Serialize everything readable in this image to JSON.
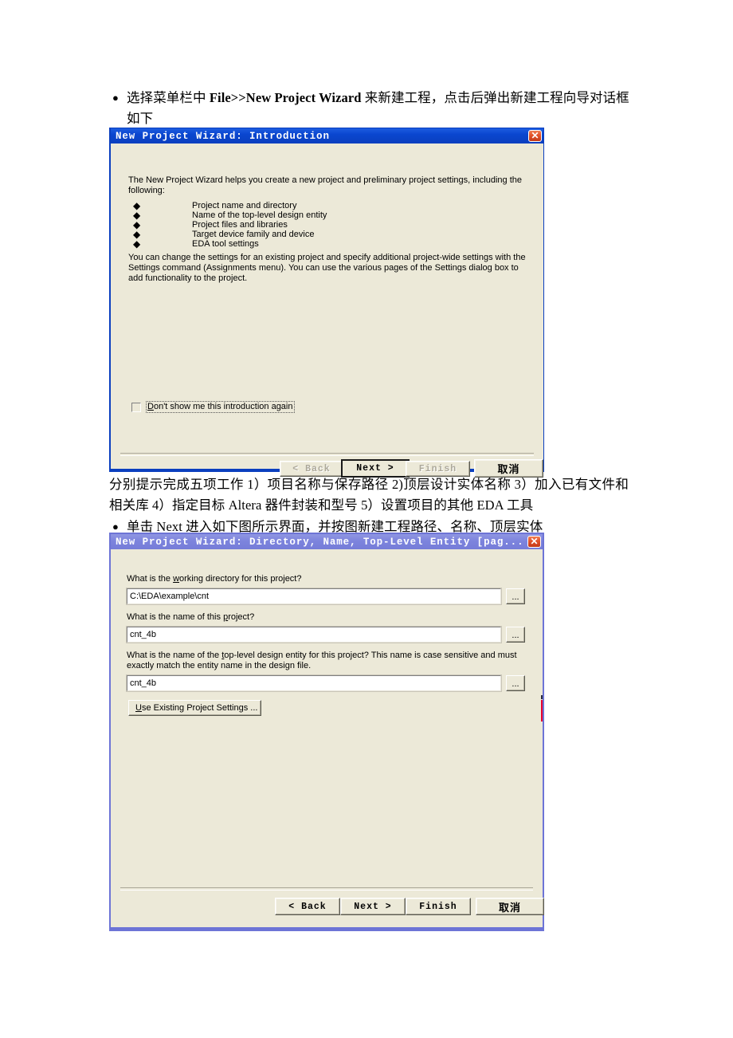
{
  "document": {
    "bullet_1": {
      "marker": "●",
      "line1_pre": "选择菜单栏中 ",
      "line1_bold": "File>>New Project Wizard",
      "line1_post": " 来新建工程，点击后弹出新建工程向导对话框",
      "line2": "如下"
    },
    "paragraph_2": "分别提示完成五项工作 1）项目名称与保存路径 2)顶层设计实体名称 3）加入已有文件和相关库 4）指定目标 Altera 器件封装和型号 5）设置项目的其他 EDA 工具",
    "bullet_2": {
      "marker": "●",
      "text": "单击 Next 进入如下图所示界面，并按图新建工程路径、名称、顶层实体"
    }
  },
  "dialog_intro": {
    "title": "New Project Wizard: Introduction",
    "close_label": "✕",
    "intro_paragraph": "The New Project Wizard helps you create a new project and preliminary project settings, including the following:",
    "bullet_marker": "◆",
    "items": [
      "Project name and directory",
      "Name of the top-level design entity",
      "Project files and libraries",
      "Target device family and device",
      "EDA tool settings"
    ],
    "body_paragraph": "You can change the settings for an existing project and specify additional project-wide settings with the Settings command (Assignments menu). You can use the various pages of the Settings dialog box to add functionality to the project.",
    "checkbox": {
      "label_accel": "D",
      "label_rest": "on't show me this introduction again",
      "checked": false
    },
    "buttons": {
      "back": "< Back",
      "next": "Next >",
      "finish": "Finish",
      "cancel": "取消"
    }
  },
  "dialog_directory": {
    "title": "New Project Wizard: Directory, Name, Top-Level Entity [pag...",
    "close_label": "✕",
    "fields": [
      {
        "label_pre": "What is the ",
        "label_accel": "w",
        "label_post": "orking directory for this project?",
        "value": "C:\\EDA\\example\\cnt",
        "browse_label": "..."
      },
      {
        "label_pre": "What is the name of this ",
        "label_accel": "p",
        "label_post": "roject?",
        "value": "cnt_4b",
        "browse_label": "..."
      },
      {
        "label_pre": "What is the name of the ",
        "label_accel": "t",
        "label_post": "op-level design entity for this project? This name is case sensitive and must exactly match the entity name in the design file.",
        "value": "cnt_4b",
        "browse_label": "..."
      }
    ],
    "use_existing_button": {
      "accel": "U",
      "rest": "se Existing Project Settings ..."
    },
    "buttons": {
      "back": "< Back",
      "next": "Next >",
      "finish": "Finish",
      "cancel": "取消"
    }
  },
  "colors": {
    "titlebar_active": "#0b3fbf",
    "titlebar_inactive": "#757cd8",
    "dialog_face": "#ece9d8",
    "close_button": "#c33a18",
    "artifact_red": "#e8002e"
  }
}
